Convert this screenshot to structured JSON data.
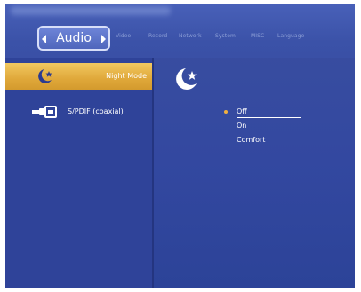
{
  "header": {
    "active_tab": "Audio",
    "tabs": [
      "Video",
      "Record",
      "Network",
      "System",
      "MISC",
      "Language"
    ]
  },
  "menu": {
    "items": [
      {
        "label": "Night Mode",
        "icon": "moon-star-icon",
        "selected": true
      },
      {
        "label": "S/PDIF (coaxial)",
        "icon": "spdif-cable-icon",
        "selected": false
      }
    ]
  },
  "detail": {
    "icon": "moon-star-icon",
    "options": [
      "Off",
      "On",
      "Comfort"
    ],
    "selected_option": "Off"
  },
  "colors": {
    "background": "#3348a0",
    "highlight": "#e0a83a",
    "bullet": "#f0b040",
    "text": "#ffffff"
  }
}
